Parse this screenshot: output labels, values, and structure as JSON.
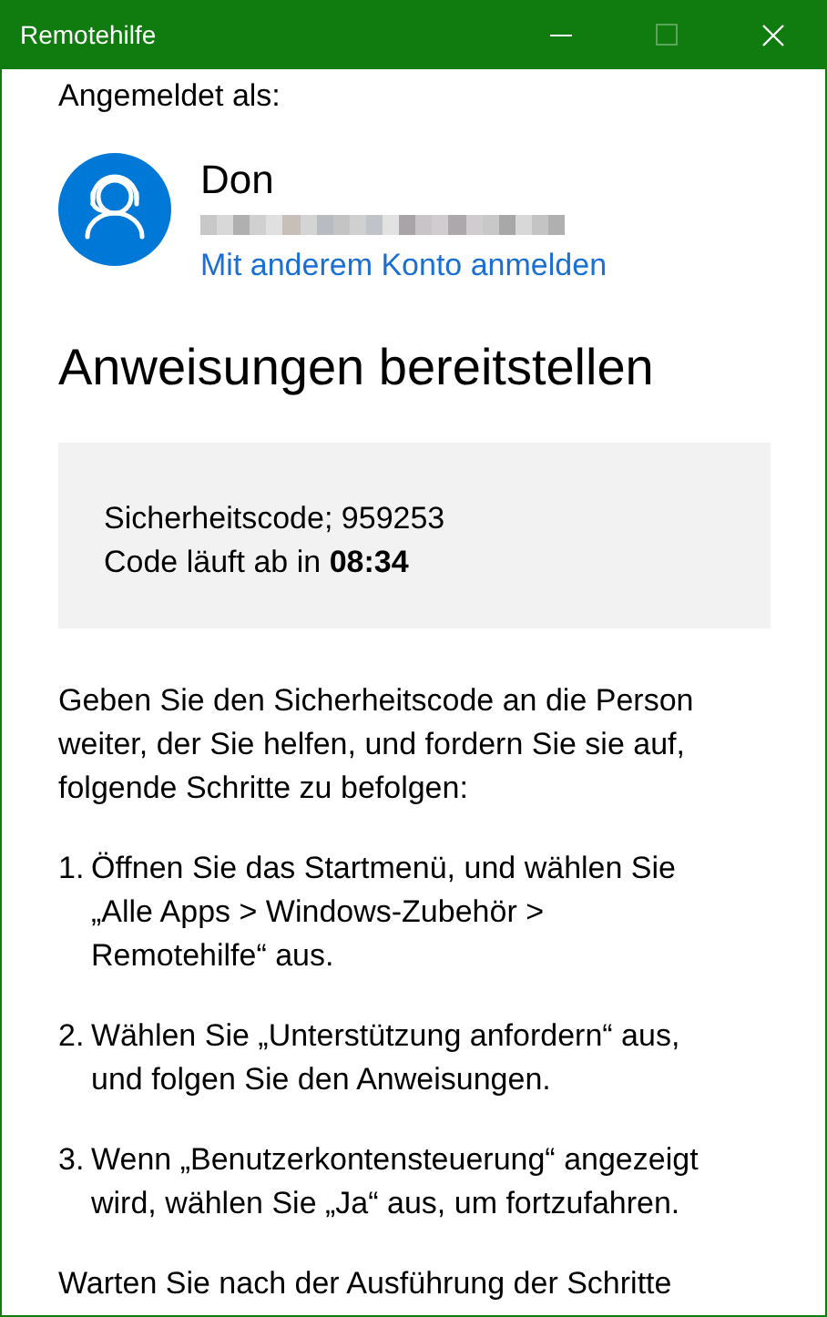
{
  "window": {
    "title": "Remotehilfe"
  },
  "signed_in_label": "Angemeldet als:",
  "account": {
    "name": "Don",
    "switch_link": "Mit anderem Konto anmelden"
  },
  "heading": "Anweisungen bereitstellen",
  "code_box": {
    "code_line": "Sicherheitscode; 959253",
    "expiry_line": "Code läuft ab in **08:34**"
  },
  "intro": "Geben Sie den Sicherheitscode an die Person weiter, der Sie helfen, und fordern Sie sie auf, folgende Schritte zu befolgen:",
  "steps": [
    {
      "number": "1.",
      "text": "Öffnen Sie das Startmenü, und wählen Sie „Alle Apps > Windows-Zubehör > Remotehilfe“ aus."
    },
    {
      "number": "2.",
      "text": "Wählen Sie „Unterstützung anfordern“ aus, und folgen Sie den Anweisungen."
    },
    {
      "number": "3.",
      "text": "Wenn „Benutzerkontensteuerung“ angezeigt wird, wählen Sie „Ja“ aus, um fortzufahren."
    }
  ],
  "footer": "Warten Sie nach der Ausführung der Schritte"
}
